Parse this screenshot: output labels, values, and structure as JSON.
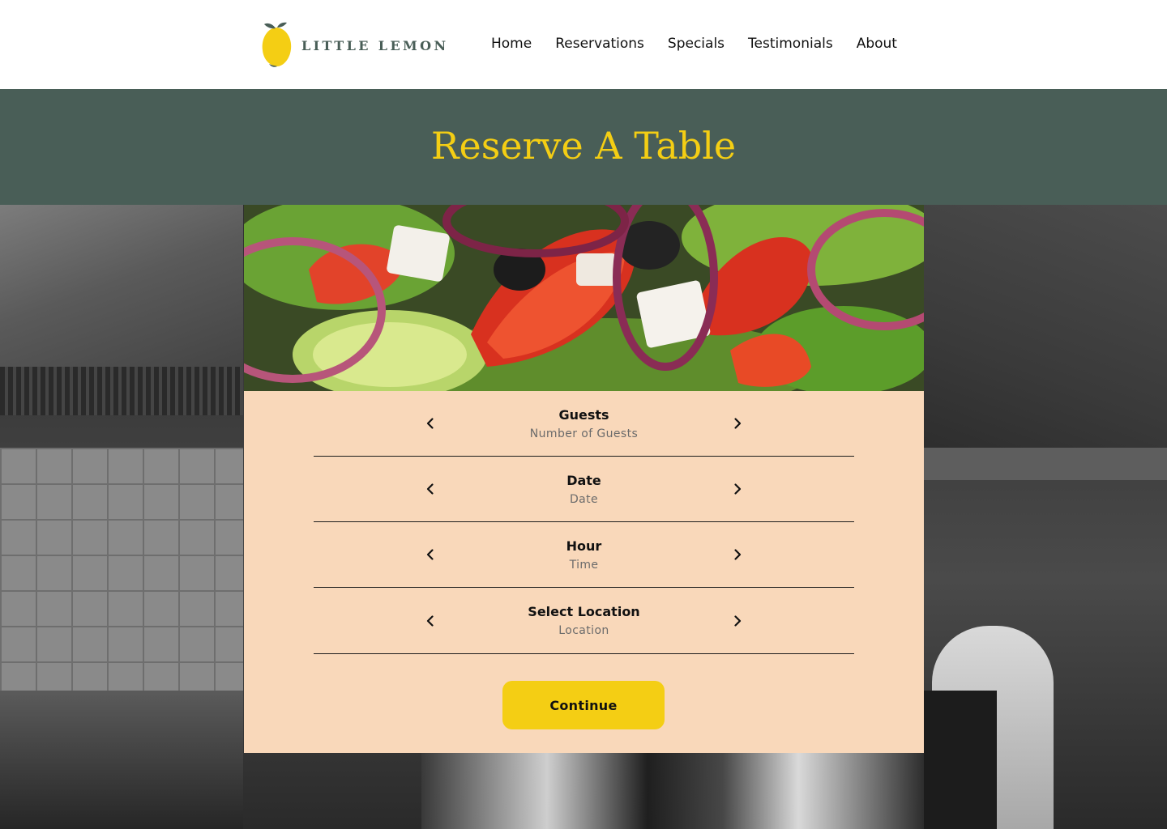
{
  "brand": {
    "name": "LITTLE LEMON"
  },
  "nav": {
    "items": [
      {
        "label": "Home"
      },
      {
        "label": "Reservations"
      },
      {
        "label": "Specials"
      },
      {
        "label": "Testimonials"
      },
      {
        "label": "About"
      }
    ]
  },
  "page": {
    "title": "Reserve A Table"
  },
  "form": {
    "rows": [
      {
        "label": "Guests",
        "value": "Number of Guests"
      },
      {
        "label": "Date",
        "value": "Date"
      },
      {
        "label": "Hour",
        "value": "Time"
      },
      {
        "label": "Select Location",
        "value": "Location"
      }
    ],
    "continue_label": "Continue"
  },
  "icons": {
    "prev": "chevron-left-icon",
    "next": "chevron-right-icon"
  },
  "colors": {
    "primary_green": "#495E57",
    "primary_yellow": "#F4CE14",
    "card_bg": "#F9D8BA",
    "logo_text": "#495E57"
  }
}
